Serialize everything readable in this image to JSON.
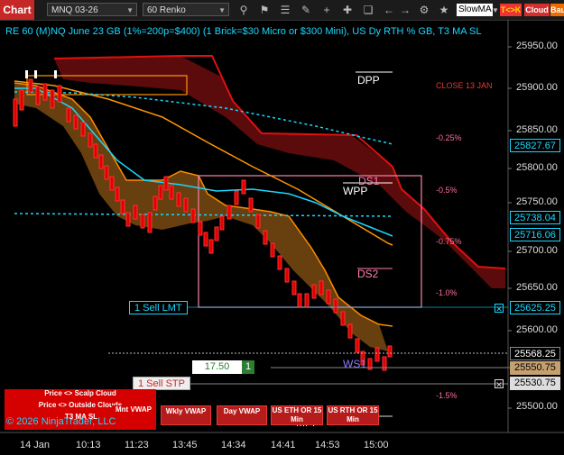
{
  "toolbar": {
    "chart_tab": "Chart",
    "instrument": "MNQ 03-26",
    "bar_type": "60 Renko",
    "ma_select": "SlowMA",
    "tk_button": "T<>K",
    "cloud_button": "Cloud",
    "bau_button": "Bau",
    "icons": [
      "search-icon",
      "flag-icon",
      "bars-icon",
      "pencil-icon",
      "plus-icon",
      "crosshair-icon",
      "copy-icon",
      "arrow-left-icon",
      "arrow-right-icon",
      "properties-icon",
      "magic-icon",
      "grid-icon"
    ]
  },
  "chart": {
    "title": "RE 60 (M)NQ June 23 GB (1%=200p=$400) (1 Brick=$30 Micro or $300 Mini), US Dy RTH % GB, T3 MA SL",
    "title_right": "-1.0%"
  },
  "labels": {
    "dpp": "DPP",
    "close_13_jan": "CLOSE 13 JAN",
    "pct_025": "-0.25%",
    "pct_05": "-0.5%",
    "pct_075": "-0.75%",
    "pct_10": "-1.0%",
    "pct_15": "-1.5%",
    "ds1": "DS1",
    "wpp": "WPP",
    "ds2": "DS2",
    "ws1": "WS1",
    "mpp": "MPP"
  },
  "price_axis": [
    "25950.00",
    "25900.00",
    "25850.00",
    "25800.00",
    "25750.00",
    "25700.00",
    "25650.00",
    "25600.00",
    "25550.00",
    "25500.00"
  ],
  "price_tags": {
    "ma1": "25827.67",
    "ma2": "25738.04",
    "ma3": "25716.06",
    "sell_lmt_price": "25625.25",
    "last": "25568.25",
    "current": "25550.75",
    "sell_stp_price": "25530.75"
  },
  "orders": {
    "sell_lmt": "1 Sell LMT",
    "sell_stp": "1 Sell STP",
    "qty_value": "17.50",
    "qty_count": "1"
  },
  "time_axis": [
    "14 Jan",
    "10:13",
    "11:23",
    "13:45",
    "14:34",
    "14:41",
    "14:53",
    "15:00"
  ],
  "panel": {
    "scalp_cloud": "Price <> Scalp Cloud",
    "outside_clouds": "Price <> Outside Clouds",
    "t3_ma_sl": "T3 MA SL",
    "mnt_vwap": "Mnt VWAP",
    "wkly_vwap": "Wkly VWAP",
    "day_vwap": "Day VWAP",
    "us_eth": "US ETH OR 15 Min",
    "us_rth": "US RTH OR 15 Min",
    "copyright": "© 2026 NinjaTrader, LLC"
  },
  "colors": {
    "accent_red": "#d50000",
    "cyan": "#19d8ff",
    "orange": "#ff9800",
    "pink": "#ff80ab"
  }
}
